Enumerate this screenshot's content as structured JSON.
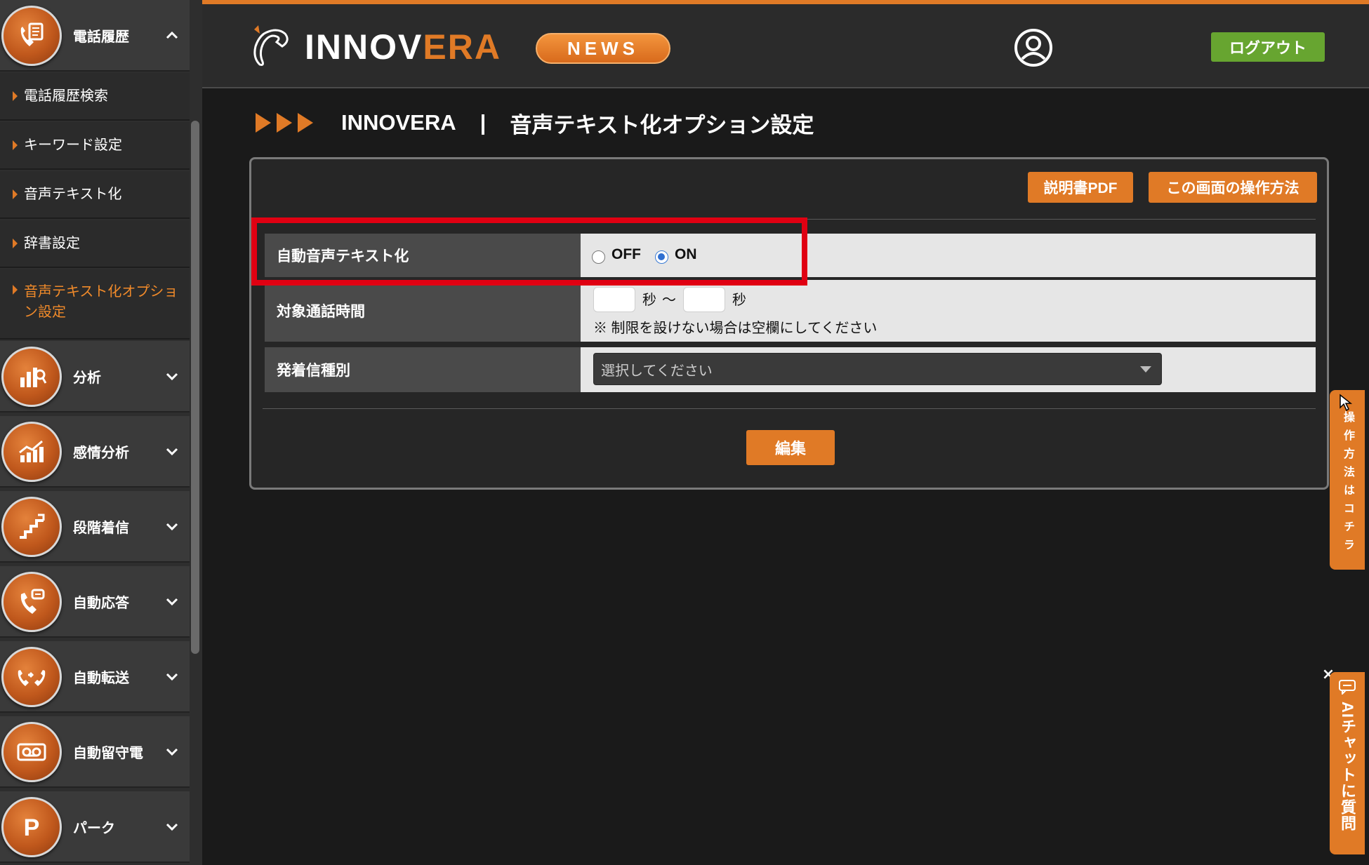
{
  "sidebar": {
    "phone_history": {
      "label": "電話履歴"
    },
    "sub_items": [
      {
        "label": "電話履歴検索"
      },
      {
        "label": "キーワード設定"
      },
      {
        "label": "音声テキスト化"
      },
      {
        "label": "辞書設定"
      },
      {
        "label": "音声テキスト化オプション設定"
      }
    ],
    "menus": [
      {
        "label": "分析"
      },
      {
        "label": "感情分析"
      },
      {
        "label": "段階着信"
      },
      {
        "label": "自動応答"
      },
      {
        "label": "自動転送"
      },
      {
        "label": "自動留守電"
      },
      {
        "label": "パーク"
      }
    ]
  },
  "header": {
    "logo_text_main": "INNOV",
    "logo_text_accent": "ERA",
    "news_label": "NEWS",
    "logout_label": "ログアウト"
  },
  "page": {
    "brand": "INNOVERA",
    "separator": "|",
    "title": "音声テキスト化オプション設定"
  },
  "panel": {
    "manual_pdf_label": "説明書PDF",
    "howto_label": "この画面の操作方法",
    "rows": {
      "auto_transcribe": {
        "label": "自動音声テキスト化",
        "off_label": "OFF",
        "on_label": "ON",
        "selected": "ON"
      },
      "call_duration": {
        "label": "対象通話時間",
        "from_value": "",
        "to_value": "",
        "unit_sec": "秒",
        "tilde": "〜",
        "note": "※ 制限を設けない場合は空欄にしてください"
      },
      "direction": {
        "label": "発着信種別",
        "placeholder": "選択してください"
      }
    },
    "edit_label": "編集"
  },
  "floating": {
    "howto_tab": "操作方法はコチラ",
    "ai_chat_tab": "AIチャットに質問",
    "close_label": "×"
  },
  "colors": {
    "accent": "#e07a26",
    "logout": "#67a530",
    "highlight": "#e00012"
  }
}
